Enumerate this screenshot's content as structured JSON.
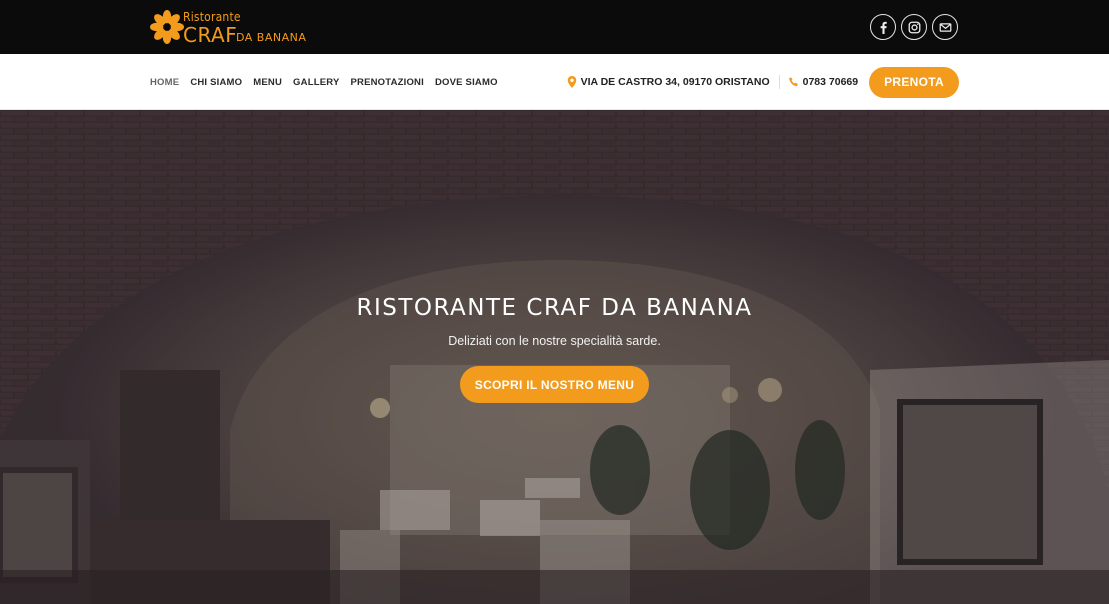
{
  "brand": {
    "logo_line1": "Ristorante",
    "logo_line2": "CRAF",
    "logo_line3": "DA BANANA",
    "accent_color": "#f39b1c"
  },
  "social": [
    "facebook-icon",
    "instagram-icon",
    "email-icon"
  ],
  "nav": {
    "items": [
      {
        "label": "HOME",
        "active": true
      },
      {
        "label": "CHI SIAMO"
      },
      {
        "label": "MENU"
      },
      {
        "label": "GALLERY"
      },
      {
        "label": "PRENOTAZIONI"
      },
      {
        "label": "DOVE SIAMO"
      }
    ],
    "address": "VIA DE CASTRO 34, 09170 ORISTANO",
    "phone": "0783 70669",
    "cta": "PRENOTA"
  },
  "hero": {
    "title": "RISTORANTE CRAF DA BANANA",
    "subtitle": "Deliziati con le nostre specialità sarde.",
    "cta": "SCOPRI IL NOSTRO MENU"
  }
}
